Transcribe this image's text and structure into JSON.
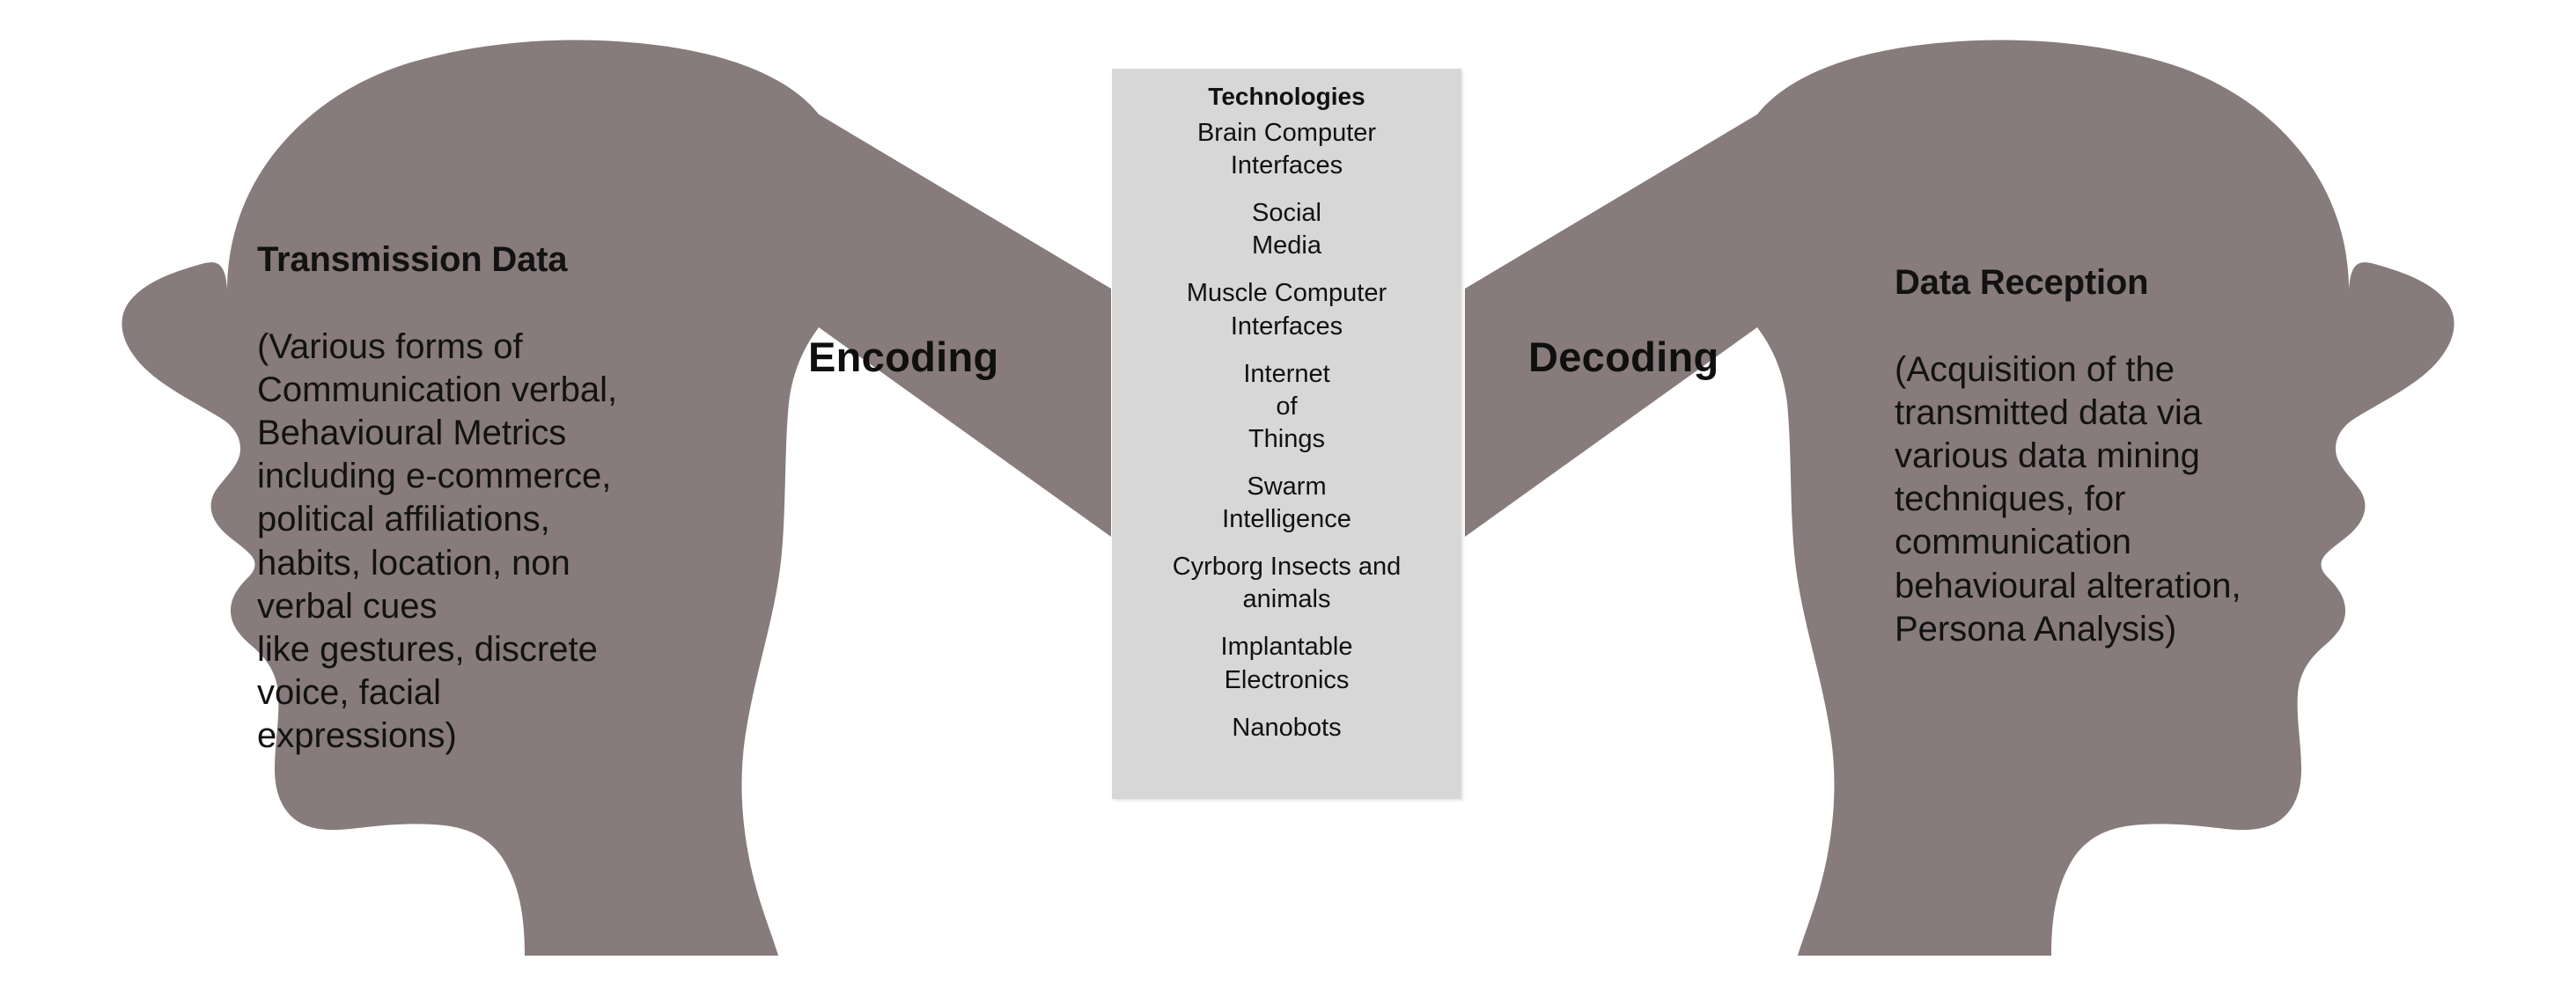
{
  "colors": {
    "silhouette": "#877b7b",
    "panel_background": "#d7d7d7",
    "page_background": "#ffffff",
    "text": "#111111"
  },
  "left_head": {
    "title": "Transmission Data",
    "body": "(Various forms of\nCommunication verbal,\nBehavioural Metrics\nincluding e-commerce,\npolitical affiliations,\nhabits, location, non\nverbal cues\nlike gestures, discrete\nvoice, facial\nexpressions)"
  },
  "right_head": {
    "title": "Data Reception",
    "body": "(Acquisition of the\ntransmitted data via\nvarious data mining\ntechniques, for\ncommunication\nbehavioural alteration,\nPersona Analysis)"
  },
  "flow": {
    "encoding_label": "Encoding",
    "decoding_label": "Decoding"
  },
  "tech_panel": {
    "title": "Technologies",
    "items": [
      "Brain Computer\nInterfaces",
      "Social\nMedia",
      "Muscle Computer\nInterfaces",
      "Internet\nof\nThings",
      "Swarm\nIntelligence",
      "Cyrborg Insects and\nanimals",
      "Implantable\nElectronics",
      "Nanobots"
    ]
  }
}
